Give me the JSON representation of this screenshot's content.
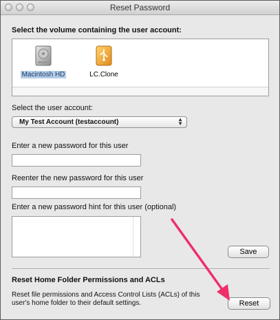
{
  "window": {
    "title": "Reset Password"
  },
  "volume_section": {
    "heading": "Select the volume containing the user account:",
    "volumes": [
      {
        "name": "Macintosh HD",
        "icon": "hard-drive-icon",
        "selected": true
      },
      {
        "name": "LC.Clone",
        "icon": "external-drive-icon",
        "selected": false
      }
    ]
  },
  "account_section": {
    "label": "Select the user account:",
    "selected_account": "My Test Account (testaccount)"
  },
  "password_section": {
    "new_password_label": "Enter a new password for this user",
    "new_password_value": "",
    "reenter_label": "Reenter the new password for this user",
    "reenter_value": "",
    "hint_label": "Enter a new password hint for this user (optional)",
    "hint_value": "",
    "save_label": "Save"
  },
  "acl_section": {
    "heading": "Reset Home Folder Permissions and ACLs",
    "description": "Reset file permissions and Access Control Lists (ACLs) of this user's home folder to their default settings.",
    "reset_label": "Reset"
  },
  "colors": {
    "annotation_arrow": "#ee2f6b",
    "selection_highlight": "#b5cde6"
  }
}
